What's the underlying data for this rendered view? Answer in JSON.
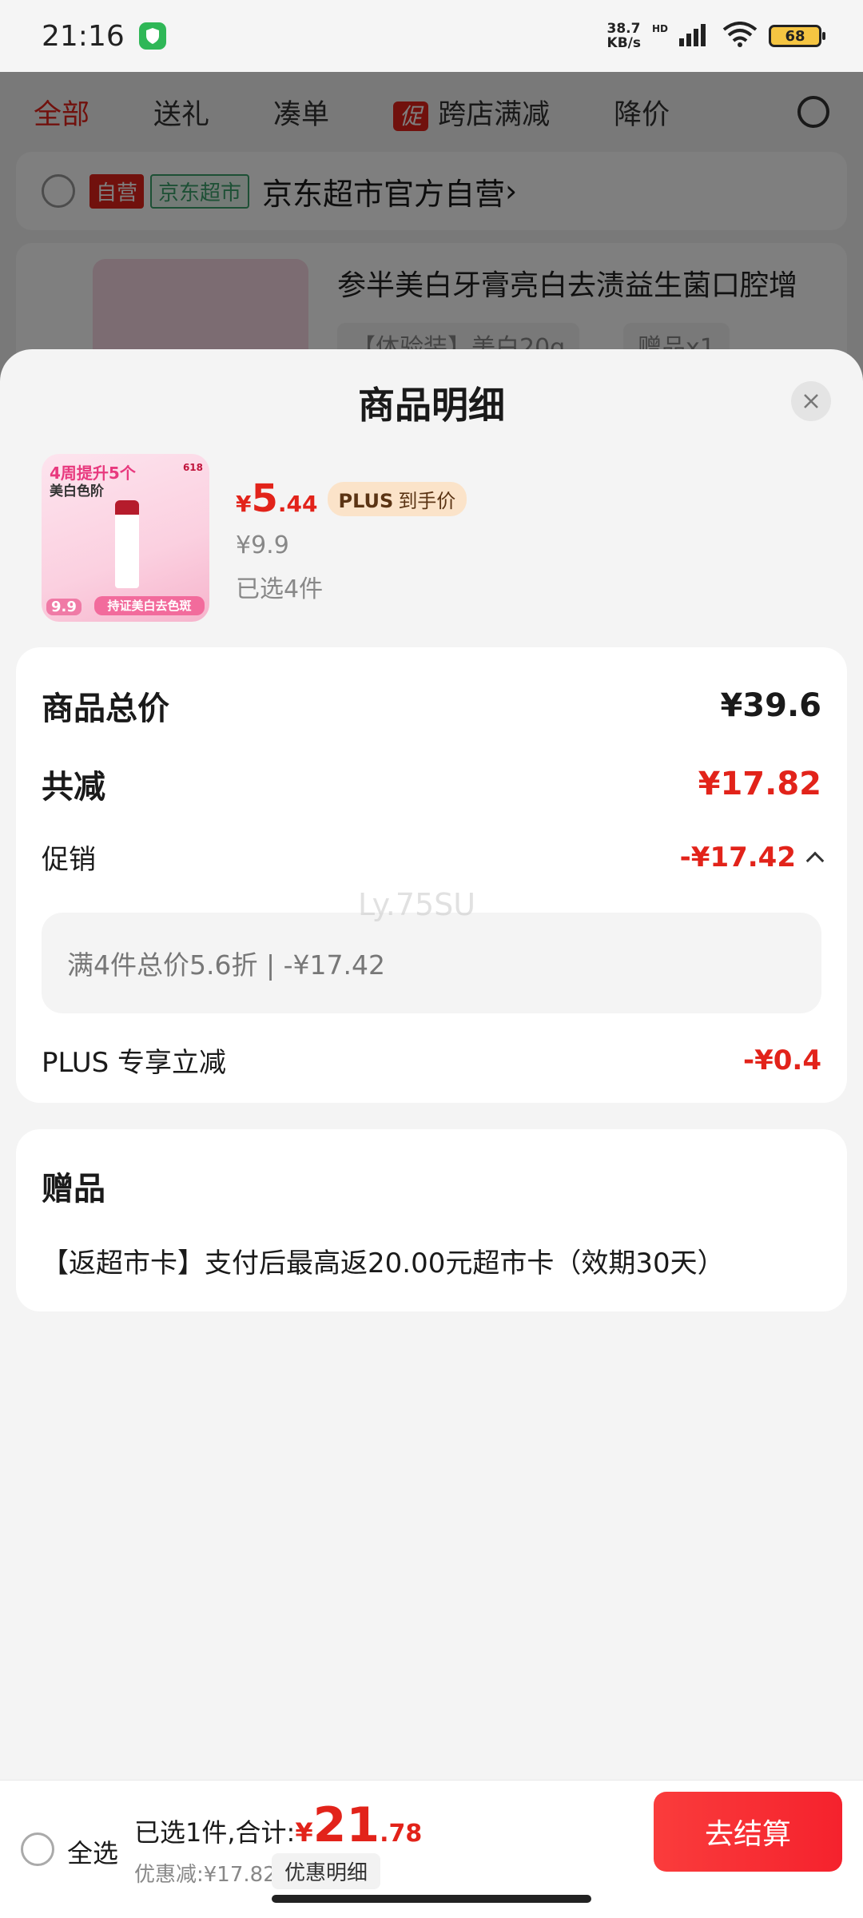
{
  "status_bar": {
    "time": "21:16",
    "net_speed_value": "38.7",
    "net_speed_unit": "KB/s",
    "hd_label": "HD",
    "battery": "68"
  },
  "background": {
    "tabs": [
      "全部",
      "送礼",
      "凑单",
      "跨店满减",
      "降价"
    ],
    "promo_badge": "促",
    "shop": {
      "tag_self": "自营",
      "tag_market": "京东超市",
      "name": "京东超市官方自营",
      "arrow": "›"
    },
    "item": {
      "title": "参半美白牙膏亮白去渍益生菌口腔增",
      "spec": "【体验装】美白20g",
      "gift": "赠品x1"
    }
  },
  "sheet": {
    "title": "商品明细",
    "product": {
      "image_headline": "4周提升5个",
      "image_subline": "美白色阶",
      "image_event": "618",
      "image_price_badge": "9.9",
      "image_strip": "持证美白去色斑",
      "price_symbol": "¥",
      "price_int": "5",
      "price_dec": ".44",
      "plus_label": "PLUS",
      "plus_suffix": "到手价",
      "original_price": "¥9.9",
      "selected": "已选4件"
    },
    "summary": {
      "total_label": "商品总价",
      "total_value": "¥39.6",
      "discount_label": "共减",
      "discount_value": "¥17.82",
      "promo_label": "促销",
      "promo_value": "-¥17.42",
      "promo_detail": "满4件总价5.6折 | -¥17.42",
      "plus_label": "PLUS 专享立减",
      "plus_value": "-¥0.4",
      "watermark": "Ly.75SU"
    },
    "gift": {
      "title": "赠品",
      "text": "【返超市卡】支付后最高返20.00元超市卡（效期30天）"
    }
  },
  "bottom_bar": {
    "select_all": "全选",
    "total_prefix": "已选1件,合计:",
    "total_symbol": "¥",
    "total_int": "21",
    "total_dec": ".78",
    "savings": "优惠减:¥17.82",
    "detail_button": "优惠明细",
    "checkout_button": "去结算"
  },
  "colors": {
    "accent_red": "#e2231a",
    "checkout_red": "#f5222d",
    "plus_tag_bg": "#fbe3c9"
  }
}
